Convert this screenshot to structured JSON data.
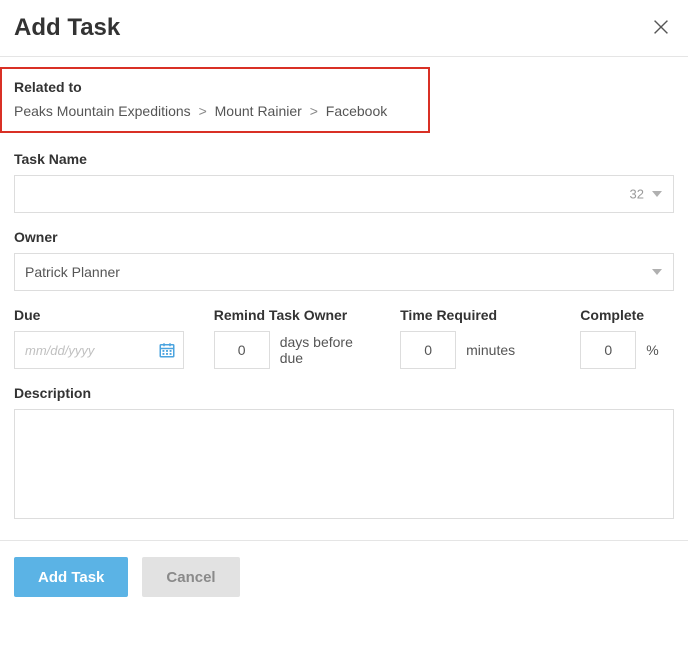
{
  "header": {
    "title": "Add Task"
  },
  "related": {
    "label": "Related to",
    "crumbs": [
      "Peaks Mountain Expeditions",
      "Mount Rainier",
      "Facebook"
    ],
    "sep": ">"
  },
  "taskName": {
    "label": "Task Name",
    "value": "",
    "counter": "32"
  },
  "owner": {
    "label": "Owner",
    "selected": "Patrick Planner"
  },
  "due": {
    "label": "Due",
    "placeholder": "mm/dd/yyyy",
    "value": ""
  },
  "remind": {
    "label": "Remind Task Owner",
    "value": "0",
    "unit": "days before due"
  },
  "timeRequired": {
    "label": "Time Required",
    "value": "0",
    "unit": "minutes"
  },
  "complete": {
    "label": "Complete",
    "value": "0",
    "unit": "%"
  },
  "description": {
    "label": "Description",
    "value": ""
  },
  "footer": {
    "primary": "Add Task",
    "secondary": "Cancel"
  }
}
